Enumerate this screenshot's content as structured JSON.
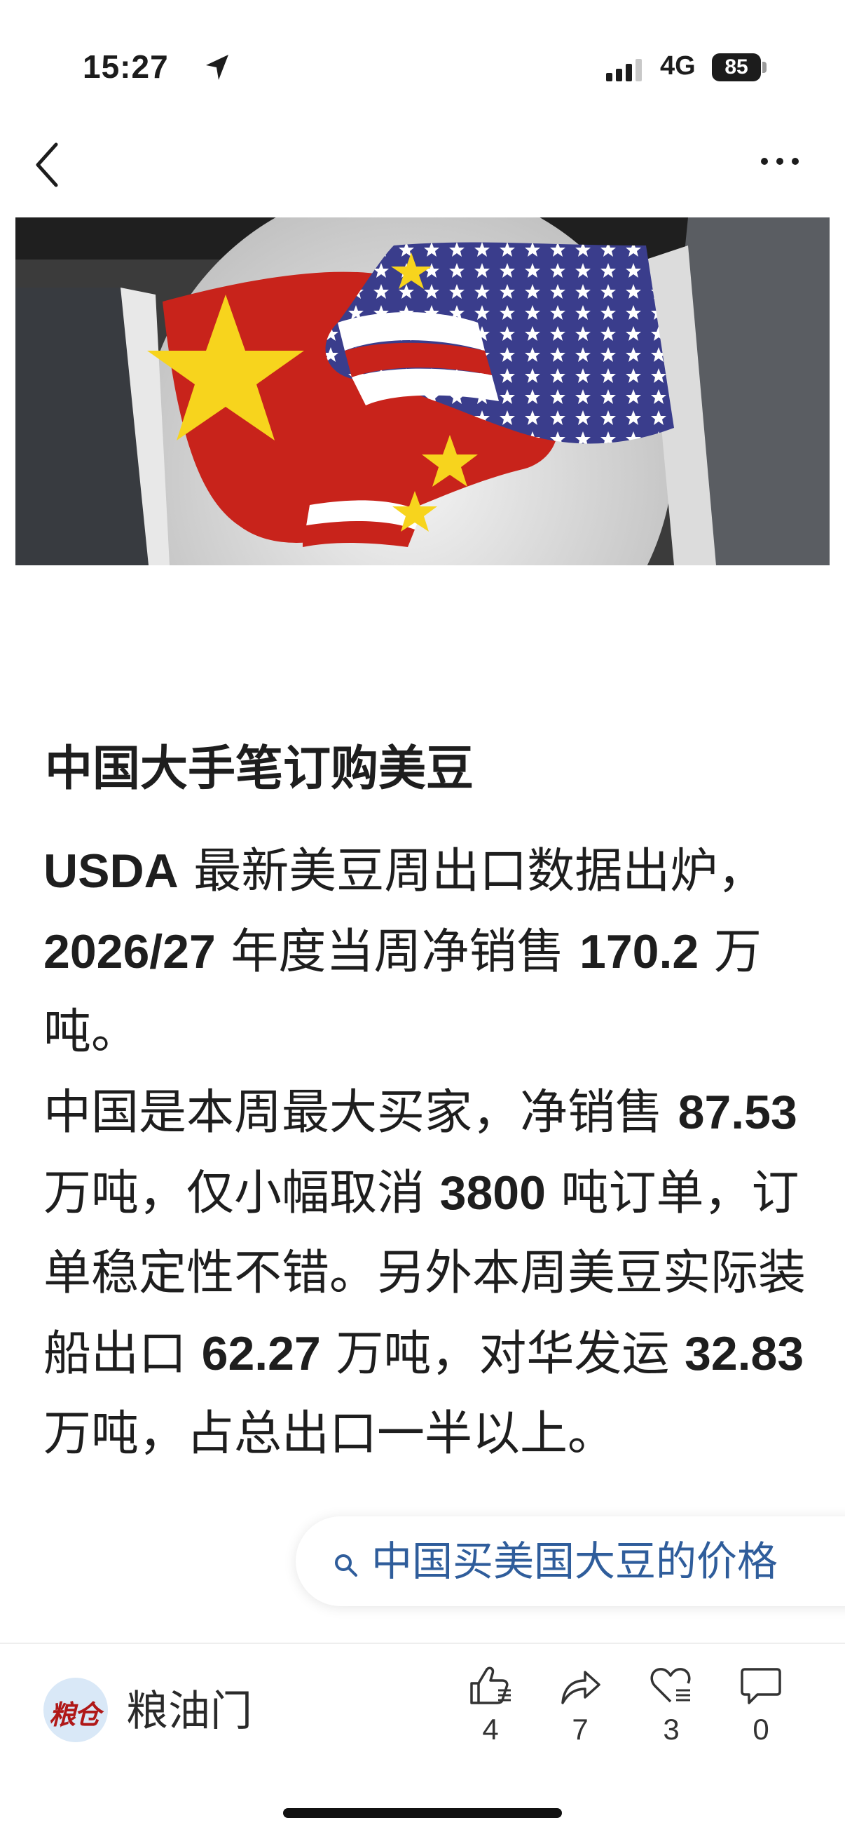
{
  "status_bar": {
    "time": "15:27",
    "network": "4G",
    "battery": "85"
  },
  "article": {
    "title": "中国大手笔订购美豆",
    "paragraphs": [
      [
        {
          "t": "USDA",
          "n": true
        },
        {
          "t": " 最新美豆周出口数据出炉，",
          "n": false
        },
        {
          "t": "2026/27",
          "n": true
        },
        {
          "t": " 年度当周净销售 ",
          "n": false
        },
        {
          "t": "170.2",
          "n": true
        },
        {
          "t": " 万吨。",
          "n": false
        }
      ],
      [
        {
          "t": "中国是本周最大买家，净销售 ",
          "n": false
        },
        {
          "t": "87.53",
          "n": true
        },
        {
          "t": " 万吨，仅小幅取消 ",
          "n": false
        },
        {
          "t": "3800",
          "n": true
        },
        {
          "t": " 吨订单，订单稳定性不错。另外本周美豆实际装船出口 ",
          "n": false
        },
        {
          "t": "62.27",
          "n": true
        },
        {
          "t": " 万吨，对华发运 ",
          "n": false
        },
        {
          "t": "32.83",
          "n": true
        },
        {
          "t": " 万吨，占总出口一半以上。",
          "n": false
        }
      ]
    ]
  },
  "search_suggestion": {
    "text": "中国买美国大豆的价格"
  },
  "author": {
    "name": "粮油门",
    "avatar_text": "粮仓"
  },
  "actions": {
    "like": "4",
    "share": "7",
    "favorite": "3",
    "comment": "0"
  },
  "icons": [
    "navigation-arrow-icon",
    "signal-icon",
    "battery-icon",
    "back-icon",
    "more-icon",
    "search-icon",
    "like-icon",
    "share-icon",
    "favorite-icon",
    "comment-icon"
  ],
  "colors": {
    "search_text": "#2f5d9b",
    "text": "#1e1e1e"
  }
}
